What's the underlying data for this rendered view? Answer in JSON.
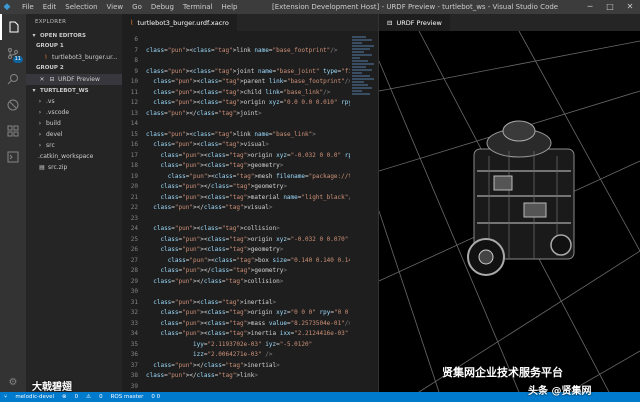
{
  "titlebar": {
    "menu": [
      "File",
      "Edit",
      "Selection",
      "View",
      "Go",
      "Debug",
      "Terminal",
      "Help"
    ],
    "title": "[Extension Development Host] - URDF Preview - turtlebot_ws - Visual Studio Code",
    "minimize": "─",
    "maximize": "□",
    "close": "✕"
  },
  "activity": {
    "badge": "11"
  },
  "sidebar": {
    "header": "EXPLORER",
    "open_editors": "OPEN EDITORS",
    "group1": "GROUP 1",
    "group1_file": "turtlebot3_burger.ur...",
    "group2": "GROUP 2",
    "group2_file": "URDF Preview",
    "workspace": "TURTLEBOT_WS",
    "folders": [
      ".vs",
      ".vscode",
      "build",
      "devel",
      "src"
    ],
    "files": [
      ".catkin_workspace",
      "src.zip"
    ]
  },
  "editor": {
    "tab": "turtlebot3_burger.urdf.xacro"
  },
  "preview": {
    "tab": "URDF Preview"
  },
  "statusbar": {
    "branch": "melodic-devel",
    "errors": "0",
    "warnings": "0",
    "ros": "ROS master",
    "counts": "0  0"
  },
  "watermark": {
    "left": "大戟碧翅",
    "right1": "贤集网企业技术服务平台",
    "right2": "头条 @贤集网"
  },
  "code_lines": [
    {
      "n": "6",
      "t": ""
    },
    {
      "n": "7",
      "t": "<link name=\"base_footprint\"/>"
    },
    {
      "n": "8",
      "t": ""
    },
    {
      "n": "9",
      "t": "<joint name=\"base_joint\" type=\"fixed\">"
    },
    {
      "n": "10",
      "t": "  <parent link=\"base_footprint\"/>"
    },
    {
      "n": "11",
      "t": "  <child link=\"base_link\"/>"
    },
    {
      "n": "12",
      "t": "  <origin xyz=\"0.0 0.0 0.010\" rpy=\"0 0 0\"/>"
    },
    {
      "n": "13",
      "t": "</joint>"
    },
    {
      "n": "14",
      "t": ""
    },
    {
      "n": "15",
      "t": "<link name=\"base_link\">"
    },
    {
      "n": "16",
      "t": "  <visual>"
    },
    {
      "n": "17",
      "t": "    <origin xyz=\"-0.032 0 0.0\" rpy=\"0 0 0\"/>"
    },
    {
      "n": "18",
      "t": "    <geometry>"
    },
    {
      "n": "19",
      "t": "      <mesh filename=\"package://turtlebot3_de"
    },
    {
      "n": "20",
      "t": "    </geometry>"
    },
    {
      "n": "21",
      "t": "    <material name=\"light_black\"/>"
    },
    {
      "n": "22",
      "t": "  </visual>"
    },
    {
      "n": "23",
      "t": ""
    },
    {
      "n": "24",
      "t": "  <collision>"
    },
    {
      "n": "25",
      "t": "    <origin xyz=\"-0.032 0 0.070\" rpy=\"0 0 0\"/"
    },
    {
      "n": "26",
      "t": "    <geometry>"
    },
    {
      "n": "27",
      "t": "      <box size=\"0.140 0.140 0.143\"/>"
    },
    {
      "n": "28",
      "t": "    </geometry>"
    },
    {
      "n": "29",
      "t": "  </collision>"
    },
    {
      "n": "30",
      "t": ""
    },
    {
      "n": "31",
      "t": "  <inertial>"
    },
    {
      "n": "32",
      "t": "    <origin xyz=\"0 0 0\" rpy=\"0 0 0\"/>"
    },
    {
      "n": "33",
      "t": "    <mass value=\"8.2573504e-01\"/>"
    },
    {
      "n": "34",
      "t": "    <inertia ixx=\"2.2124416e-03\" ixy=\"-1.2294"
    },
    {
      "n": "35",
      "t": "             iyy=\"2.1193702e-03\" iyz=\"-5.0120"
    },
    {
      "n": "36",
      "t": "             izz=\"2.0064271e-03\" />"
    },
    {
      "n": "37",
      "t": "  </inertial>"
    },
    {
      "n": "38",
      "t": "</link>"
    },
    {
      "n": "39",
      "t": ""
    },
    {
      "n": "40",
      "t": "<joint name=\"wheel_left_joint\" type=\"continuo"
    },
    {
      "n": "41",
      "t": "  <parent link=\"base_link\"/>"
    }
  ]
}
